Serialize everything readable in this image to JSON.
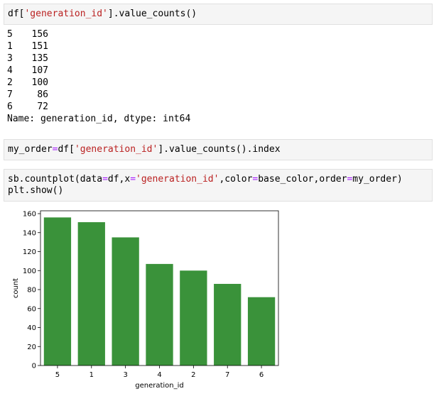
{
  "cells": {
    "cell1": {
      "prefix": "df[",
      "str": "'generation_id'",
      "suffix": "].value_counts()"
    },
    "cell2": {
      "var": "my_order",
      "eq": "=",
      "df": "df[",
      "str": "'generation_id'",
      "suffix": "].value_counts().index"
    },
    "cell3": {
      "p1": "sb.countplot(data",
      "eq1": "=",
      "p2": "df,x",
      "eq2": "=",
      "str": "'generation_id'",
      "p3": ",color",
      "eq3": "=",
      "p4": "base_color,order",
      "eq4": "=",
      "p5": "my_order)",
      "line2": "plt.show()"
    }
  },
  "output": {
    "value_counts": [
      {
        "key": "5",
        "val": "156"
      },
      {
        "key": "1",
        "val": "151"
      },
      {
        "key": "3",
        "val": "135"
      },
      {
        "key": "4",
        "val": "107"
      },
      {
        "key": "2",
        "val": "100"
      },
      {
        "key": "7",
        "val": "86"
      },
      {
        "key": "6",
        "val": "72"
      }
    ],
    "footer": "Name: generation_id, dtype: int64"
  },
  "chart_data": {
    "type": "bar",
    "categories": [
      "5",
      "1",
      "3",
      "4",
      "2",
      "7",
      "6"
    ],
    "values": [
      156,
      151,
      135,
      107,
      100,
      86,
      72
    ],
    "title": "",
    "xlabel": "generation_id",
    "ylabel": "count",
    "ylim": [
      0,
      163
    ],
    "yticks": [
      0,
      20,
      40,
      60,
      80,
      100,
      120,
      140,
      160
    ],
    "grid": false,
    "bar_color": "#3a923a"
  }
}
